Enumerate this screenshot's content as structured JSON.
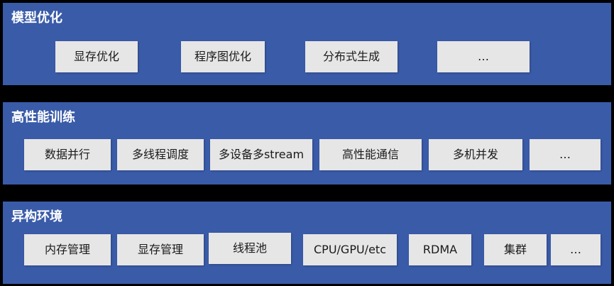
{
  "layers": [
    {
      "title": "模型优化",
      "items": [
        "显存优化",
        "程序图优化",
        "分布式生成",
        "…"
      ]
    },
    {
      "title": "高性能训练",
      "items": [
        "数据并行",
        "多线程调度",
        "多设备多stream",
        "高性能通信",
        "多机并发",
        "…"
      ]
    },
    {
      "title": "异构环境",
      "items": [
        "内存管理",
        "显存管理",
        "线程池",
        "CPU/GPU/etc",
        "RDMA",
        "集群",
        "…"
      ]
    }
  ],
  "colors": {
    "background": "#000000",
    "layer": "#3a5ba8",
    "box": "#e6e6e6",
    "title_text": "#ffffff",
    "box_text": "#1a1a1a"
  }
}
